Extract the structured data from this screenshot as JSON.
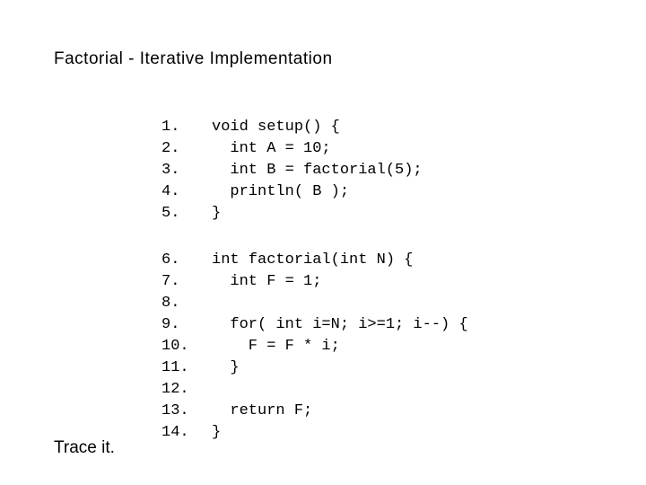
{
  "title": "Factorial - Iterative  Implementation",
  "block1": [
    {
      "num": "1.",
      "code": "void setup() {"
    },
    {
      "num": "2.",
      "code": "  int A = 10;"
    },
    {
      "num": "3.",
      "code": "  int B = factorial(5);"
    },
    {
      "num": "4.",
      "code": "  println( B );"
    },
    {
      "num": "5.",
      "code": "}"
    }
  ],
  "block2": [
    {
      "num": "6.",
      "code": "int factorial(int N) {"
    },
    {
      "num": "7.",
      "code": "  int F = 1;"
    },
    {
      "num": "8.",
      "code": ""
    },
    {
      "num": "9.",
      "code": "  for( int i=N; i>=1; i--) {"
    },
    {
      "num": "10.",
      "code": "    F = F * i;"
    },
    {
      "num": "11.",
      "code": "  }"
    },
    {
      "num": "12.",
      "code": ""
    },
    {
      "num": "13.",
      "code": "  return F;"
    },
    {
      "num": "14.",
      "code": "}"
    }
  ],
  "footer": "Trace it."
}
